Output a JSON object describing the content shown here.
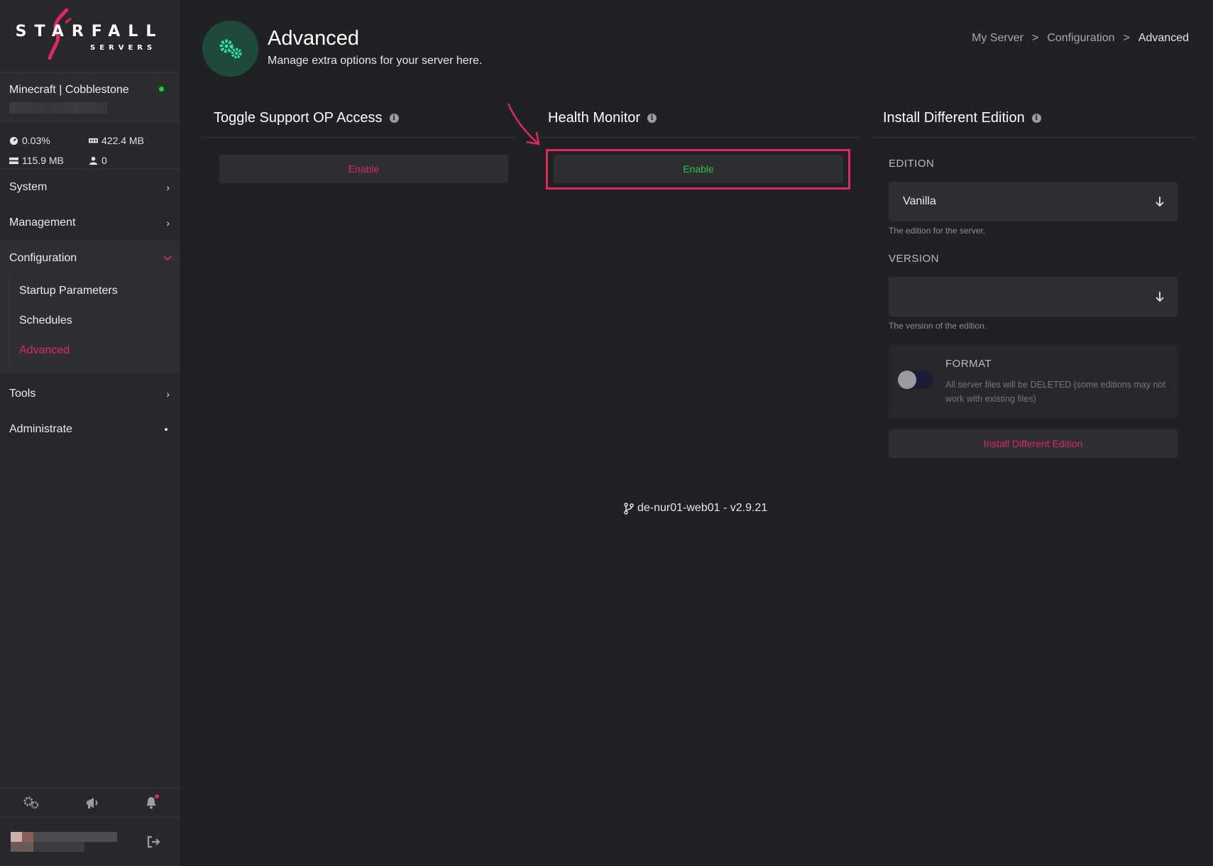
{
  "brand": {
    "name": "STARFALL",
    "sub": "SERVERS"
  },
  "server": {
    "name": "Minecraft | Cobblestone",
    "status_color": "#2bc43f",
    "stats": {
      "cpu": "0.03%",
      "memory": "422.4 MB",
      "disk": "115.9 MB",
      "players": "0"
    }
  },
  "sidebar": {
    "system": "System",
    "management": "Management",
    "configuration": "Configuration",
    "config_items": [
      "Startup Parameters",
      "Schedules",
      "Advanced"
    ],
    "tools": "Tools",
    "administrate": "Administrate"
  },
  "header": {
    "title": "Advanced",
    "subtitle": "Manage extra options for your server here.",
    "breadcrumb": [
      "My Server",
      ">",
      "Configuration",
      ">",
      "Advanced"
    ]
  },
  "panels": {
    "op_access": {
      "title": "Toggle Support OP Access",
      "button": "Enable",
      "button_color": "#e0275e"
    },
    "health": {
      "title": "Health Monitor",
      "button": "Enable",
      "button_color": "#2bc43f"
    },
    "install": {
      "title": "Install Different Edition",
      "edition_label": "EDITION",
      "edition_value": "Vanilla",
      "edition_hint": "The edition for the server.",
      "version_label": "VERSION",
      "version_value": "",
      "version_hint": "The version of the edition.",
      "format_label": "FORMAT",
      "format_desc": "All server files will be DELETED (some editions may not work with existing files)",
      "format_enabled": false,
      "button": "Install Different Edition"
    }
  },
  "footer": {
    "version": "de-nur01-web01 - v2.9.21"
  },
  "colors": {
    "accent": "#e0275e",
    "success": "#2bc43f",
    "background": "#1f2125",
    "sidebar": "#26282c"
  }
}
